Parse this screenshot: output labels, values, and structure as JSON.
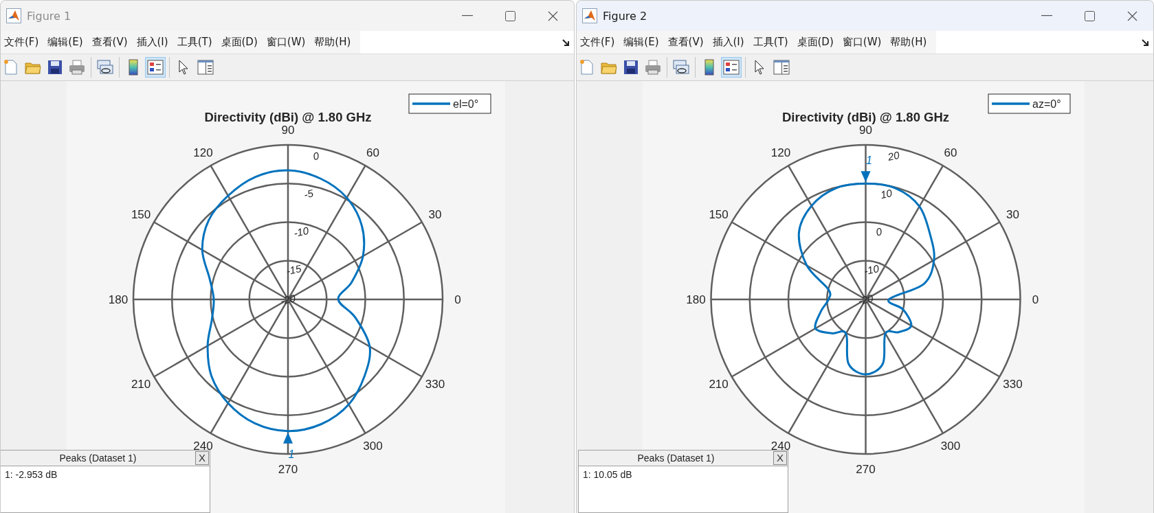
{
  "windows": [
    {
      "title": "Figure 1",
      "active": false,
      "menu": [
        "文件(F)",
        "编辑(E)",
        "查看(V)",
        "插入(I)",
        "工具(T)",
        "桌面(D)",
        "窗口(W)",
        "帮助(H)"
      ],
      "toolbar": [
        {
          "kind": "new",
          "pressed": false
        },
        {
          "kind": "open",
          "pressed": false
        },
        {
          "kind": "save",
          "pressed": false
        },
        {
          "kind": "print",
          "pressed": false
        },
        {
          "kind": "separator"
        },
        {
          "kind": "link",
          "pressed": false
        },
        {
          "kind": "separator"
        },
        {
          "kind": "colorbar",
          "pressed": false
        },
        {
          "kind": "legend",
          "pressed": true
        },
        {
          "kind": "separator"
        },
        {
          "kind": "pointer",
          "pressed": false
        },
        {
          "kind": "inspector",
          "pressed": false
        }
      ],
      "plot": {
        "title": "Directivity (dBi) @ 1.80 GHz",
        "legend": "el=0°",
        "angle_labels": [
          "0",
          "30",
          "60",
          "90",
          "120",
          "150",
          "180",
          "210",
          "240",
          "270",
          "300",
          "330"
        ],
        "radial_labels": [
          "-20",
          "-15",
          "-10",
          "-5",
          "0"
        ],
        "peak_label": "1"
      },
      "peaks": {
        "title": "Peaks (Dataset 1)",
        "close": "X",
        "entries": [
          "1: -2.953 dB"
        ]
      }
    },
    {
      "title": "Figure 2",
      "active": true,
      "menu": [
        "文件(F)",
        "编辑(E)",
        "查看(V)",
        "插入(I)",
        "工具(T)",
        "桌面(D)",
        "窗口(W)",
        "帮助(H)"
      ],
      "toolbar": [
        {
          "kind": "new",
          "pressed": false
        },
        {
          "kind": "open",
          "pressed": false
        },
        {
          "kind": "save",
          "pressed": false
        },
        {
          "kind": "print",
          "pressed": false
        },
        {
          "kind": "separator"
        },
        {
          "kind": "link",
          "pressed": false
        },
        {
          "kind": "separator"
        },
        {
          "kind": "colorbar",
          "pressed": false
        },
        {
          "kind": "legend",
          "pressed": true
        },
        {
          "kind": "separator"
        },
        {
          "kind": "pointer",
          "pressed": false
        },
        {
          "kind": "inspector",
          "pressed": false
        }
      ],
      "plot": {
        "title": "Directivity (dBi) @ 1.80 GHz",
        "legend": "az=0°",
        "angle_labels": [
          "0",
          "30",
          "60",
          "90",
          "120",
          "150",
          "180",
          "210",
          "240",
          "270",
          "300",
          "330"
        ],
        "radial_labels": [
          "-20",
          "-10",
          "0",
          "10",
          "20"
        ],
        "peak_label": "1"
      },
      "peaks": {
        "title": "Peaks (Dataset 1)",
        "close": "X",
        "entries": [
          "1: 10.05 dB"
        ]
      }
    }
  ]
}
